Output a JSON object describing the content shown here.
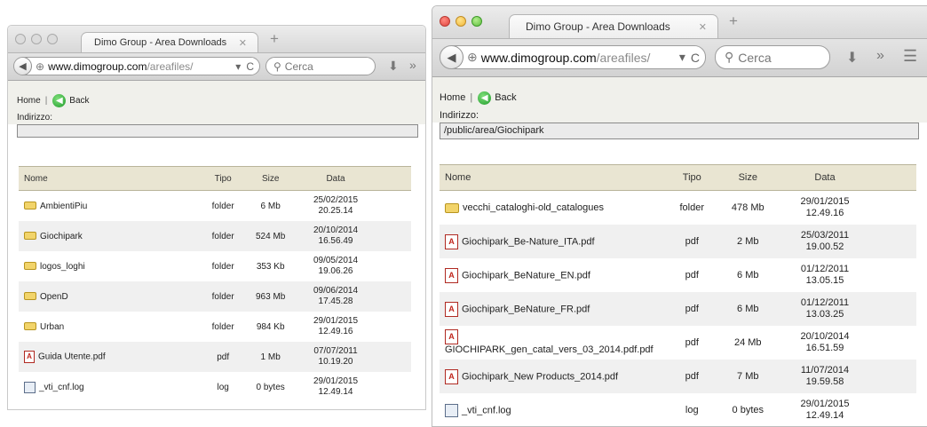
{
  "window1": {
    "tab_title": "Dimo Group - Area Downloads",
    "url_host": "www.dimogroup.com",
    "url_path": "/areafiles/",
    "search_placeholder": "Cerca",
    "home_label": "Home",
    "separator": "|",
    "back_label": "Back",
    "address_label": "Indirizzo:",
    "address_value": "",
    "columns": [
      "Nome",
      "Tipo",
      "Size",
      "Data"
    ],
    "rows": [
      {
        "icon": "folder-icon",
        "name": "AmbientiPiu",
        "type": "folder",
        "size": "6 Mb",
        "date": "25/02/2015",
        "time": "20.25.14"
      },
      {
        "icon": "folder-icon",
        "name": "Giochipark",
        "type": "folder",
        "size": "524 Mb",
        "date": "20/10/2014",
        "time": "16.56.49"
      },
      {
        "icon": "folder-icon",
        "name": "logos_loghi",
        "type": "folder",
        "size": "353 Kb",
        "date": "09/05/2014",
        "time": "19.06.26"
      },
      {
        "icon": "folder-icon",
        "name": "OpenD",
        "type": "folder",
        "size": "963 Mb",
        "date": "09/06/2014",
        "time": "17.45.28"
      },
      {
        "icon": "folder-icon",
        "name": "Urban",
        "type": "folder",
        "size": "984 Kb",
        "date": "29/01/2015",
        "time": "12.49.16"
      },
      {
        "icon": "pdf-icon",
        "name": "Guida Utente.pdf",
        "type": "pdf",
        "size": "1 Mb",
        "date": "07/07/2011",
        "time": "10.19.20"
      },
      {
        "icon": "log-icon",
        "name": "_vti_cnf.log",
        "type": "log",
        "size": "0 bytes",
        "date": "29/01/2015",
        "time": "12.49.14"
      }
    ]
  },
  "window2": {
    "tab_title": "Dimo Group - Area Downloads",
    "url_host": "www.dimogroup.com",
    "url_path": "/areafiles/",
    "search_placeholder": "Cerca",
    "home_label": "Home",
    "separator": "|",
    "back_label": "Back",
    "address_label": "Indirizzo:",
    "address_value": "/public/area/Giochipark",
    "columns": [
      "Nome",
      "Tipo",
      "Size",
      "Data"
    ],
    "rows": [
      {
        "icon": "folder-icon",
        "name": "vecchi_cataloghi-old_catalogues",
        "type": "folder",
        "size": "478 Mb",
        "date": "29/01/2015",
        "time": "12.49.16"
      },
      {
        "icon": "pdf-icon",
        "name": "Giochipark_Be-Nature_ITA.pdf",
        "type": "pdf",
        "size": "2 Mb",
        "date": "25/03/2011",
        "time": "19.00.52"
      },
      {
        "icon": "pdf-icon",
        "name": "Giochipark_BeNature_EN.pdf",
        "type": "pdf",
        "size": "6 Mb",
        "date": "01/12/2011",
        "time": "13.05.15"
      },
      {
        "icon": "pdf-icon",
        "name": "Giochipark_BeNature_FR.pdf",
        "type": "pdf",
        "size": "6 Mb",
        "date": "01/12/2011",
        "time": "13.03.25"
      },
      {
        "icon": "pdf-icon",
        "name": "GIOCHIPARK_gen_catal_vers_03_2014.pdf.pdf",
        "type": "pdf",
        "size": "24 Mb",
        "date": "20/10/2014",
        "time": "16.51.59"
      },
      {
        "icon": "pdf-icon",
        "name": "Giochipark_New Products_2014.pdf",
        "type": "pdf",
        "size": "7 Mb",
        "date": "11/07/2014",
        "time": "19.59.58"
      },
      {
        "icon": "log-icon",
        "name": "_vti_cnf.log",
        "type": "log",
        "size": "0 bytes",
        "date": "29/01/2015",
        "time": "12.49.14"
      }
    ]
  }
}
